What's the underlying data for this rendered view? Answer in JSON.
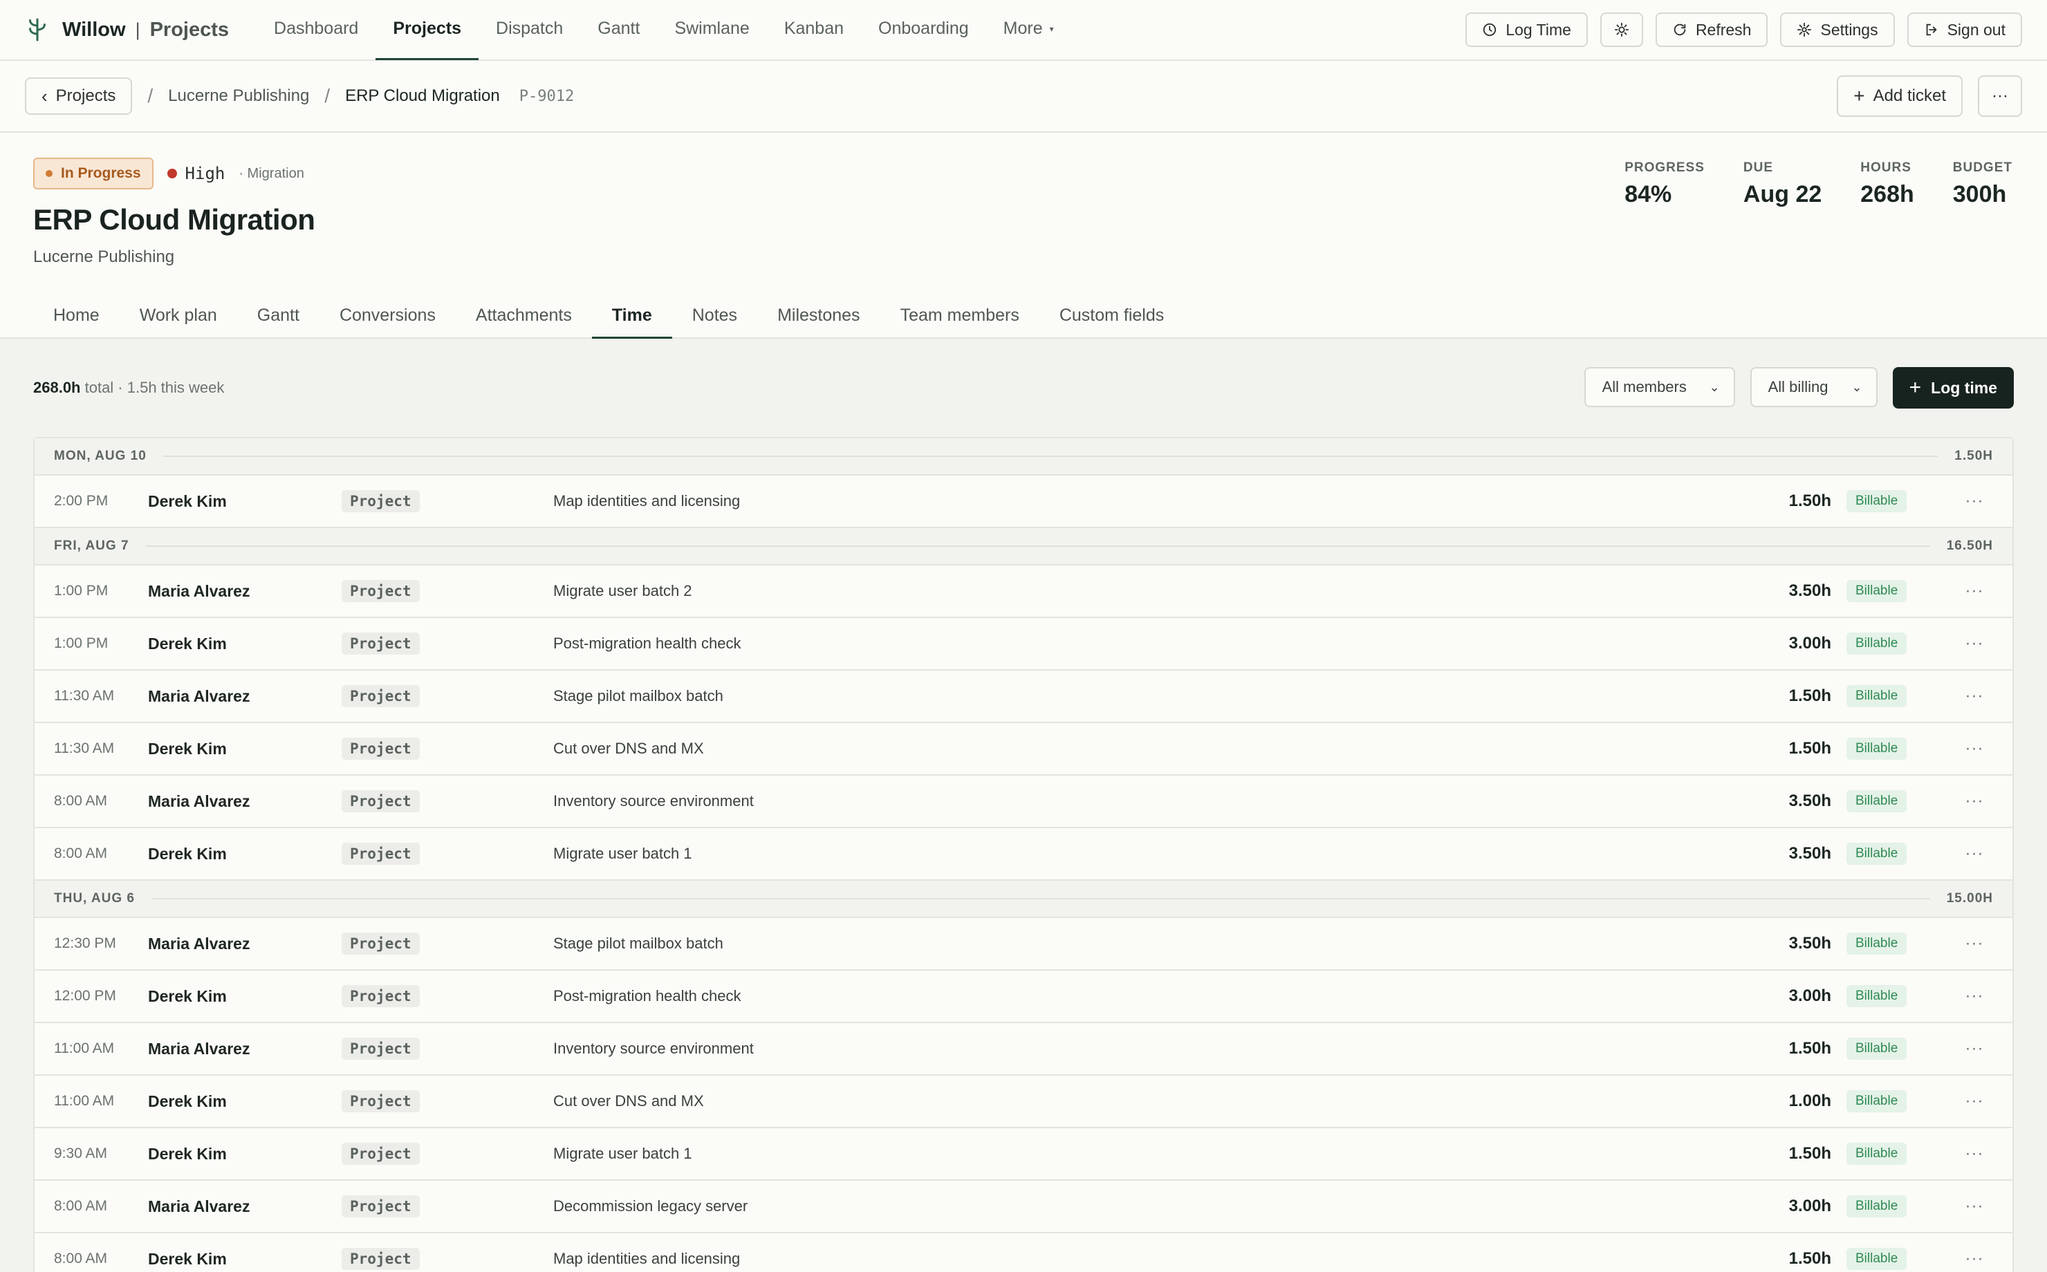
{
  "app": {
    "name": "Willow",
    "separator": "|",
    "section": "Projects",
    "logo_icon": "leaf-logo-icon"
  },
  "nav": {
    "links": [
      {
        "label": "Dashboard",
        "active": false
      },
      {
        "label": "Projects",
        "active": true
      },
      {
        "label": "Dispatch",
        "active": false
      },
      {
        "label": "Gantt",
        "active": false
      },
      {
        "label": "Swimlane",
        "active": false
      },
      {
        "label": "Kanban",
        "active": false
      },
      {
        "label": "Onboarding",
        "active": false
      }
    ],
    "more_label": "More",
    "actions": {
      "log_time": "Log Time",
      "refresh": "Refresh",
      "settings": "Settings",
      "sign_out": "Sign out"
    }
  },
  "breadcrumb": {
    "back_label": "Projects",
    "client": "Lucerne Publishing",
    "current": "ERP Cloud Migration",
    "id": "P-9012",
    "add_ticket": "Add ticket",
    "more": "···"
  },
  "project": {
    "status": "In Progress",
    "priority": "High",
    "category": "· Migration",
    "title": "ERP Cloud Migration",
    "client": "Lucerne Publishing",
    "stats": [
      {
        "label": "PROGRESS",
        "value": "84%"
      },
      {
        "label": "DUE",
        "value": "Aug 22"
      },
      {
        "label": "HOURS",
        "value": "268h"
      },
      {
        "label": "BUDGET",
        "value": "300h"
      }
    ],
    "colors": {
      "status_bg": "#f9e7d5",
      "status_text": "#a65b1f",
      "priority_dot": "#c0392b",
      "accent": "#1f4434"
    }
  },
  "tabs": [
    {
      "label": "Home",
      "active": false
    },
    {
      "label": "Work plan",
      "active": false
    },
    {
      "label": "Gantt",
      "active": false
    },
    {
      "label": "Conversions",
      "active": false
    },
    {
      "label": "Attachments",
      "active": false
    },
    {
      "label": "Time",
      "active": true
    },
    {
      "label": "Notes",
      "active": false
    },
    {
      "label": "Milestones",
      "active": false
    },
    {
      "label": "Team members",
      "active": false
    },
    {
      "label": "Custom fields",
      "active": false
    }
  ],
  "time": {
    "total": "268.0h",
    "summary_rest": " total · 1.5h this week",
    "filters": {
      "members": "All members",
      "billing": "All billing"
    },
    "log_button": "Log time",
    "days": [
      {
        "label": "MON, AUG 10",
        "total": "1.50H",
        "entries": [
          {
            "time": "2:00 PM",
            "member": "Derek Kim",
            "type": "Project",
            "desc": "Map identities and licensing",
            "hours": "1.50h",
            "billing": "Billable"
          }
        ]
      },
      {
        "label": "FRI, AUG 7",
        "total": "16.50H",
        "entries": [
          {
            "time": "1:00 PM",
            "member": "Maria Alvarez",
            "type": "Project",
            "desc": "Migrate user batch 2",
            "hours": "3.50h",
            "billing": "Billable"
          },
          {
            "time": "1:00 PM",
            "member": "Derek Kim",
            "type": "Project",
            "desc": "Post-migration health check",
            "hours": "3.00h",
            "billing": "Billable"
          },
          {
            "time": "11:30 AM",
            "member": "Maria Alvarez",
            "type": "Project",
            "desc": "Stage pilot mailbox batch",
            "hours": "1.50h",
            "billing": "Billable"
          },
          {
            "time": "11:30 AM",
            "member": "Derek Kim",
            "type": "Project",
            "desc": "Cut over DNS and MX",
            "hours": "1.50h",
            "billing": "Billable"
          },
          {
            "time": "8:00 AM",
            "member": "Maria Alvarez",
            "type": "Project",
            "desc": "Inventory source environment",
            "hours": "3.50h",
            "billing": "Billable"
          },
          {
            "time": "8:00 AM",
            "member": "Derek Kim",
            "type": "Project",
            "desc": "Migrate user batch 1",
            "hours": "3.50h",
            "billing": "Billable"
          }
        ]
      },
      {
        "label": "THU, AUG 6",
        "total": "15.00H",
        "entries": [
          {
            "time": "12:30 PM",
            "member": "Maria Alvarez",
            "type": "Project",
            "desc": "Stage pilot mailbox batch",
            "hours": "3.50h",
            "billing": "Billable"
          },
          {
            "time": "12:00 PM",
            "member": "Derek Kim",
            "type": "Project",
            "desc": "Post-migration health check",
            "hours": "3.00h",
            "billing": "Billable"
          },
          {
            "time": "11:00 AM",
            "member": "Maria Alvarez",
            "type": "Project",
            "desc": "Inventory source environment",
            "hours": "1.50h",
            "billing": "Billable"
          },
          {
            "time": "11:00 AM",
            "member": "Derek Kim",
            "type": "Project",
            "desc": "Cut over DNS and MX",
            "hours": "1.00h",
            "billing": "Billable"
          },
          {
            "time": "9:30 AM",
            "member": "Derek Kim",
            "type": "Project",
            "desc": "Migrate user batch 1",
            "hours": "1.50h",
            "billing": "Billable"
          },
          {
            "time": "8:00 AM",
            "member": "Maria Alvarez",
            "type": "Project",
            "desc": "Decommission legacy server",
            "hours": "3.00h",
            "billing": "Billable"
          },
          {
            "time": "8:00 AM",
            "member": "Derek Kim",
            "type": "Project",
            "desc": "Map identities and licensing",
            "hours": "1.50h",
            "billing": "Billable"
          }
        ]
      }
    ]
  }
}
